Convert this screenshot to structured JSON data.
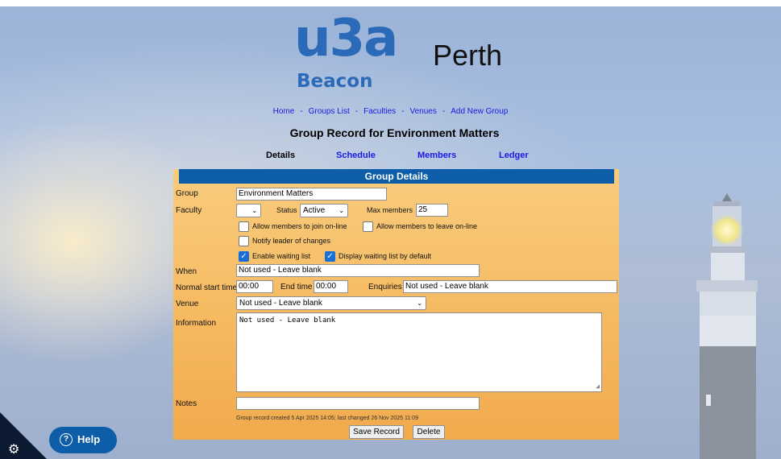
{
  "header": {
    "logo_mark": "u3a",
    "logo_sub": "Beacon",
    "site_name": "Perth"
  },
  "nav": {
    "items": [
      "Home",
      "Groups List",
      "Faculties",
      "Venues",
      "Add New Group"
    ],
    "separator": "-"
  },
  "page_title": "Group Record for Environment Matters",
  "tabs": [
    {
      "label": "Details",
      "active": true
    },
    {
      "label": "Schedule",
      "active": false
    },
    {
      "label": "Members",
      "active": false
    },
    {
      "label": "Ledger",
      "active": false
    }
  ],
  "panel": {
    "title": "Group Details",
    "group": {
      "label": "Group",
      "value": "Environment Matters"
    },
    "faculty": {
      "label": "Faculty",
      "value": ""
    },
    "status": {
      "label": "Status",
      "value": "Active"
    },
    "max_members": {
      "label": "Max members",
      "value": "25"
    },
    "checkboxes": {
      "join_online": {
        "label": "Allow members to join on-line",
        "checked": false
      },
      "leave_online": {
        "label": "Allow members to leave on-line",
        "checked": false
      },
      "notify_leader": {
        "label": "Notify leader of changes",
        "checked": false
      },
      "waiting_list": {
        "label": "Enable waiting list",
        "checked": true
      },
      "display_waiting": {
        "label": "Display waiting list by default",
        "checked": true
      }
    },
    "when": {
      "label": "When",
      "value": "Not used - Leave blank"
    },
    "start_time": {
      "label": "Normal start time",
      "value": "00:00"
    },
    "end_time": {
      "label": "End time",
      "value": "00:00"
    },
    "enquiries": {
      "label": "Enquiries",
      "value": "Not used - Leave blank"
    },
    "venue": {
      "label": "Venue",
      "value": "Not used - Leave blank"
    },
    "information": {
      "label": "Information",
      "value": "Not used - Leave blank"
    },
    "notes": {
      "label": "Notes",
      "value": ""
    },
    "record_meta": "Group record created 5 Apr 2025 14:05; last changed 26 Nov 2025 11:09",
    "save_label": "Save Record",
    "delete_label": "Delete"
  },
  "help": {
    "label": "Help"
  },
  "colors": {
    "brand_blue": "#2a6ab8",
    "panel_header": "#0d5da8",
    "panel_bg": "#f6b85e",
    "link": "#1a1ae6",
    "checkbox_on": "#1a6fd6"
  },
  "icons": [
    "settings-gear-icon",
    "help-question-icon",
    "chevron-down-icon",
    "checkmark-icon",
    "resize-handle-icon"
  ]
}
